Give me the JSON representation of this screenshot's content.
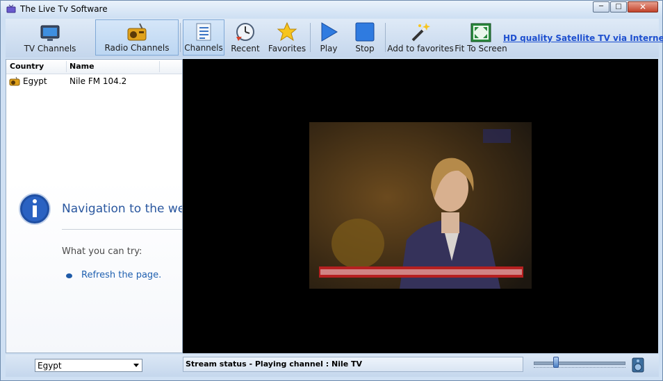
{
  "window": {
    "title": "The Live Tv Software"
  },
  "toolbar": {
    "tv_channels": "TV Channels",
    "radio_channels": "Radio Channels",
    "channels": "Channels",
    "recent": "Recent",
    "favorites": "Favorites",
    "play": "Play",
    "stop": "Stop",
    "add_to_favorites": "Add to favorites",
    "fit_to_screen": "Fit To Screen",
    "hd_link": "HD quality Satellite TV via Internet"
  },
  "channel_list": {
    "columns": [
      "Country",
      "Name"
    ],
    "rows": [
      {
        "country": "Egypt",
        "name": "Nile FM 104.2"
      }
    ]
  },
  "error_panel": {
    "title": "Navigation to the web",
    "try_label": "What you can try:",
    "link": "Refresh the page."
  },
  "status": {
    "country_selected": "Egypt",
    "stream_status": "Stream status - Playing channel : Nile TV"
  },
  "colors": {
    "accent": "#2a579f",
    "link": "#1d4fcf",
    "video_bg": "#000000"
  }
}
